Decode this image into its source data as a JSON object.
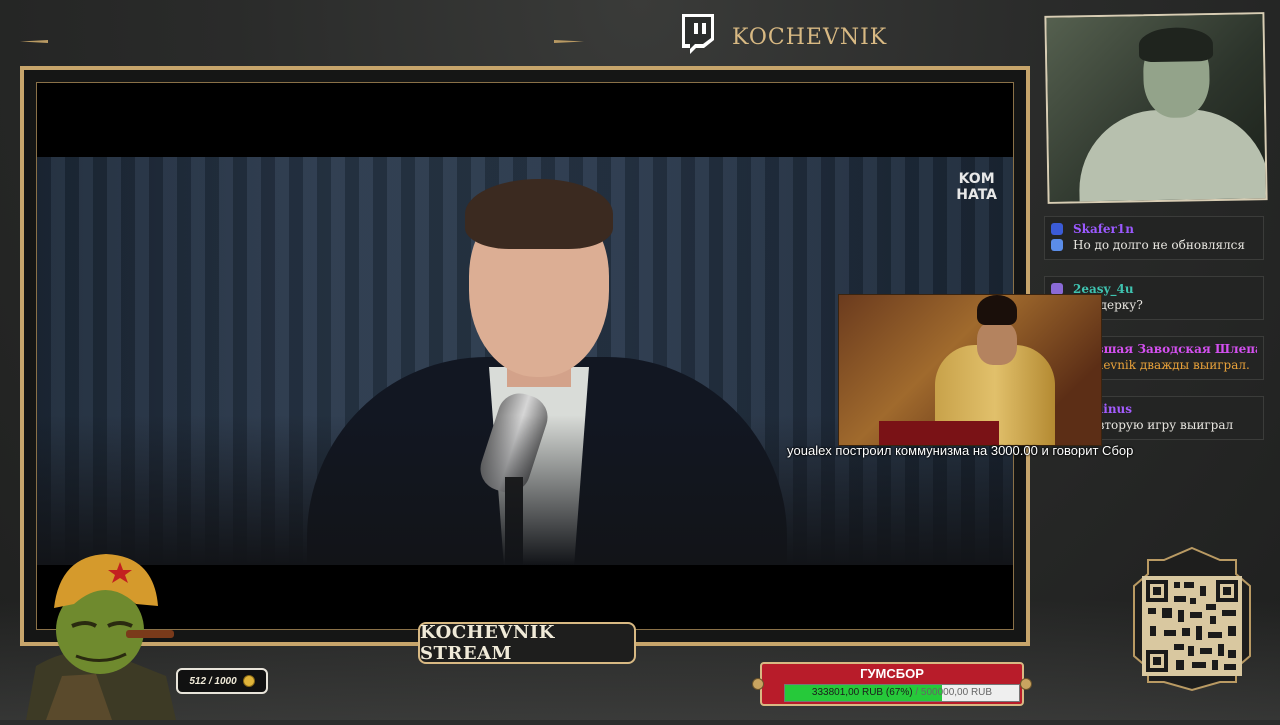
{
  "header": {
    "brand_title": "KOCHEVNIK",
    "platform_icon": "twitch-icon"
  },
  "video": {
    "watermark_line1": "KOM",
    "watermark_line2": "HATA"
  },
  "overlay": {
    "donation_message": "youalex  построил коммунизма на 3000.00  и говорит Сбор"
  },
  "chat": {
    "messages": [
      {
        "user": "Skafer1n",
        "user_color": "#9b59ff",
        "text": "Но до долго не обновлялся"
      },
      {
        "user": "2easy_4u",
        "user_color": "#3fc3b0",
        "text": "по ядерку?"
      },
      {
        "user": "Бывшая Заводская Шлепа",
        "user_color": "#d450f0",
        "text": "Kochevnik дважды выиграл.",
        "text_color": "#e9a23a"
      },
      {
        "user": "Apolinus",
        "user_color": "#a55cff",
        "text": "где вторую игру выиграл"
      }
    ]
  },
  "bottom": {
    "stream_label": "KOCHEVNIK STREAM",
    "counter": "512 / 1000",
    "counter_icon": "coin-icon",
    "goal": {
      "title": "ГУМСБОР",
      "current": "333801,00 RUB (67%)",
      "separator": " / ",
      "max": "500000,00 RUB",
      "progress_fraction": 0.67
    }
  },
  "colors": {
    "accent_gold": "#c7a56b",
    "goal_red": "#b81c2a",
    "goal_fill": "#26c93a"
  }
}
